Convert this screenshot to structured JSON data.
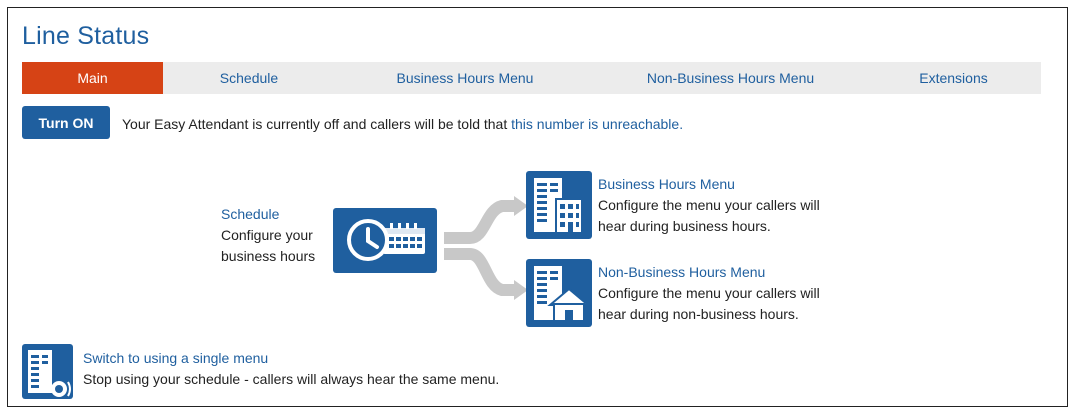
{
  "header": {
    "title": "Line Status"
  },
  "tabs": [
    {
      "label": "Main",
      "active": true
    },
    {
      "label": "Schedule",
      "active": false
    },
    {
      "label": "Business Hours Menu",
      "active": false
    },
    {
      "label": "Non-Business Hours Menu",
      "active": false
    },
    {
      "label": "Extensions",
      "active": false
    }
  ],
  "status": {
    "button_label": "Turn ON",
    "message": "Your Easy Attendant is currently off and callers will be told that ",
    "link_text": "this number is unreachable."
  },
  "schedule": {
    "link": "Schedule",
    "line1": "Configure your",
    "line2": "business hours",
    "icon": "clock-calendar-icon"
  },
  "business_menu": {
    "link": "Business Hours Menu",
    "line1": "Configure the menu your callers will",
    "line2": "hear during business hours.",
    "icon": "office-building-icon"
  },
  "nonbusiness_menu": {
    "link": "Non-Business Hours Menu",
    "line1": "Configure the menu your callers will",
    "line2": "hear during non-business hours.",
    "icon": "house-icon"
  },
  "single_menu": {
    "link": "Switch to using a single menu",
    "description": "Stop using your schedule - callers will always hear the same menu.",
    "icon": "single-menu-speaker-icon"
  },
  "colors": {
    "brand_blue": "#1f5f9f",
    "active_tab": "#d64315",
    "tab_bar": "#ececec",
    "arrow_gray": "#c8c8c8"
  }
}
